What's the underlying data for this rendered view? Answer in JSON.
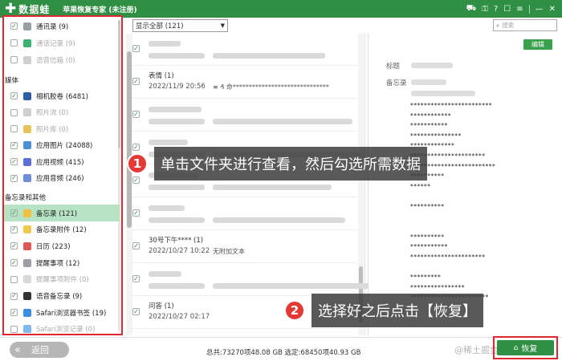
{
  "app": {
    "logo_text": "数据蛙",
    "title": "苹果恢复专家 (未注册)",
    "window_buttons": [
      "cart-icon",
      "key-icon",
      "help-icon",
      "chat-icon",
      "menu-icon",
      "minimize-icon",
      "close-icon"
    ]
  },
  "sidebar": {
    "items": [
      {
        "label": "通讯录 (9)",
        "checked": true,
        "dim": false,
        "icon": "contacts-icon"
      },
      {
        "label": "通话记录 (9)",
        "checked": false,
        "dim": true,
        "icon": "phone-icon"
      },
      {
        "label": "语音信箱 (0)",
        "checked": false,
        "dim": true,
        "icon": "voicemail-icon"
      }
    ],
    "media_header": "媒体",
    "media_items": [
      {
        "label": "相机胶卷 (6481)",
        "checked": true,
        "dim": false,
        "icon": "camera-icon"
      },
      {
        "label": "照片流 (0)",
        "checked": false,
        "dim": true,
        "icon": "photostream-icon"
      },
      {
        "label": "照片库 (0)",
        "checked": false,
        "dim": true,
        "icon": "photolib-icon"
      },
      {
        "label": "应用图片 (24088)",
        "checked": true,
        "dim": false,
        "icon": "app-photo-icon"
      },
      {
        "label": "应用视频 (415)",
        "checked": true,
        "dim": false,
        "icon": "app-video-icon"
      },
      {
        "label": "应用音频 (246)",
        "checked": true,
        "dim": false,
        "icon": "app-audio-icon"
      }
    ],
    "memo_header": "备忘录和其他",
    "memo_items": [
      {
        "label": "备忘录 (121)",
        "checked": true,
        "dim": false,
        "selected": true,
        "icon": "notes-icon"
      },
      {
        "label": "备忘录附件 (12)",
        "checked": true,
        "dim": false,
        "icon": "notes-attach-icon"
      },
      {
        "label": "日历 (223)",
        "checked": true,
        "dim": false,
        "icon": "calendar-icon"
      },
      {
        "label": "提醒事项 (12)",
        "checked": true,
        "dim": false,
        "icon": "reminder-icon"
      },
      {
        "label": "提醒事项附件 (0)",
        "checked": false,
        "dim": true,
        "icon": "reminder-attach-icon"
      },
      {
        "label": "语音备忘录 (9)",
        "checked": true,
        "dim": false,
        "icon": "voice-memo-icon"
      },
      {
        "label": "Safari浏览器书签 (19)",
        "checked": true,
        "dim": false,
        "icon": "safari-icon"
      },
      {
        "label": "Safari浏览记录 (0)",
        "checked": false,
        "dim": true,
        "icon": "safari-history-icon"
      }
    ]
  },
  "toolbar": {
    "filter_value": "显示全部 (121)",
    "search_placeholder": "搜索"
  },
  "list": {
    "rows": [
      {
        "t1": "",
        "t2": "",
        "t3": "",
        "checked": true,
        "blurred": true
      },
      {
        "t1": "表情 (1)",
        "t2": "2022/11/9 20:56",
        "t3": "≡ ₰ 命******************************",
        "checked": true,
        "blurred": false
      },
      {
        "t1": "",
        "t2": "",
        "t3": "",
        "checked": true,
        "blurred": true
      },
      {
        "t1": "",
        "t2": "",
        "t3": "",
        "checked": true,
        "blurred": true
      },
      {
        "t1": "",
        "t2": "",
        "t3": "",
        "checked": true,
        "blurred": true
      },
      {
        "t1": "",
        "t2": "",
        "t3": "",
        "checked": true,
        "blurred": true
      },
      {
        "t1": "30号下午**** (1)",
        "t2": "2022/10/27 10:22",
        "t3": "无附加文本",
        "checked": true,
        "blurred": false
      },
      {
        "t1": "",
        "t2": "",
        "t3": "",
        "checked": true,
        "blurred": true
      },
      {
        "t1": "问答 (1)",
        "t2": "2022/10/27 02:17",
        "t3": "",
        "checked": true,
        "blurred": false
      }
    ]
  },
  "detail": {
    "edit_label": "编辑",
    "field_title": "标题",
    "field_memo": "备忘录",
    "lines": [
      "************************",
      "************",
      "***********",
      "***************",
      "*************",
      "**********************",
      "*************************",
      "**********",
      "******",
      "",
      "**********",
      "",
      "",
      "**********",
      "***********",
      "**********************",
      "",
      "*********",
      "****************",
      "***********************"
    ]
  },
  "callouts": {
    "one_num": "1",
    "one_text": "单击文件夹进行查看，然后勾选所需数据",
    "two_num": "2",
    "two_text": "选择好之后点击【恢复】"
  },
  "bottom": {
    "back_label": "返回",
    "totals": "总共:73270项48.08 GB 选定:68450项40.93 GB",
    "recover_label": "恢复",
    "watermark": "@稀土掘金技术社区"
  },
  "colors": {
    "brand_green": "#2f8f44",
    "highlight_red": "#e0282e",
    "selected_row": "#b6e3c4"
  }
}
